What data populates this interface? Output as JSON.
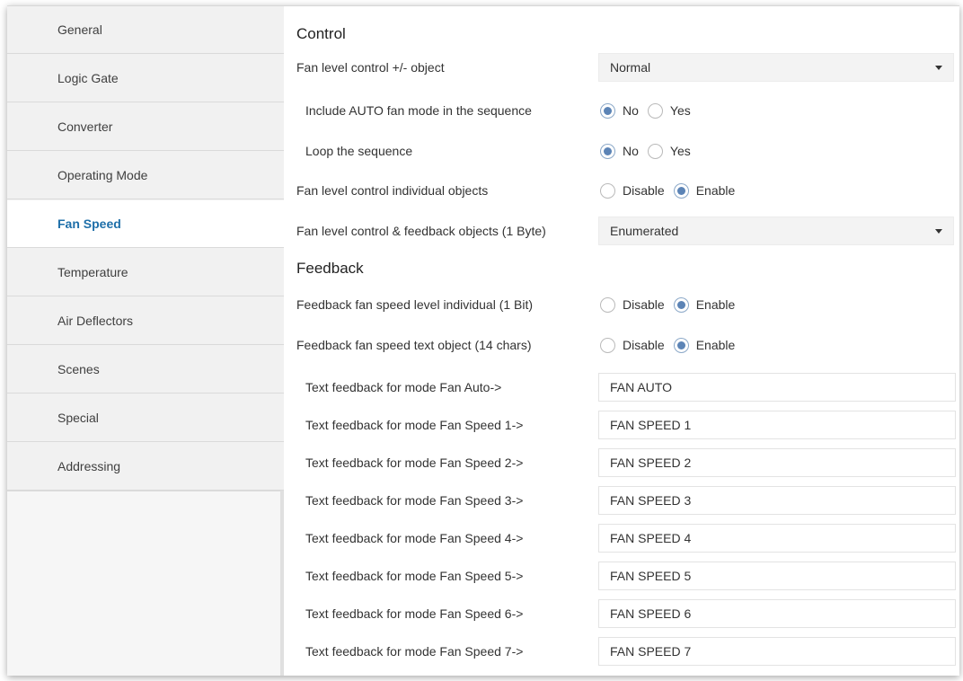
{
  "sidebar": {
    "items": [
      {
        "label": "General"
      },
      {
        "label": "Logic Gate"
      },
      {
        "label": "Converter"
      },
      {
        "label": "Operating Mode"
      },
      {
        "label": "Fan Speed",
        "active": true
      },
      {
        "label": "Temperature"
      },
      {
        "label": "Air Deflectors"
      },
      {
        "label": "Scenes"
      },
      {
        "label": "Special"
      },
      {
        "label": "Addressing"
      }
    ]
  },
  "control": {
    "title": "Control",
    "fan_level_pm": {
      "label": "Fan level control +/- object",
      "value": "Normal"
    },
    "include_auto": {
      "label": "Include AUTO fan mode in the sequence",
      "options": [
        "No",
        "Yes"
      ],
      "selected": "No"
    },
    "loop_sequence": {
      "label": "Loop the sequence",
      "options": [
        "No",
        "Yes"
      ],
      "selected": "No"
    },
    "individual_objects": {
      "label": "Fan level control individual objects",
      "options": [
        "Disable",
        "Enable"
      ],
      "selected": "Enable"
    },
    "byte_objects": {
      "label": "Fan level control & feedback objects (1 Byte)",
      "value": "Enumerated"
    }
  },
  "feedback": {
    "title": "Feedback",
    "level_individual": {
      "label": "Feedback fan speed level individual (1 Bit)",
      "options": [
        "Disable",
        "Enable"
      ],
      "selected": "Enable"
    },
    "text_object": {
      "label": "Feedback fan speed text object (14 chars)",
      "options": [
        "Disable",
        "Enable"
      ],
      "selected": "Enable"
    },
    "texts": [
      {
        "label": "Text feedback for mode Fan Auto->",
        "value": "FAN AUTO"
      },
      {
        "label": "Text feedback for mode Fan Speed 1->",
        "value": "FAN SPEED 1"
      },
      {
        "label": "Text feedback for mode Fan Speed 2->",
        "value": "FAN SPEED 2"
      },
      {
        "label": "Text feedback for mode Fan Speed 3->",
        "value": "FAN SPEED 3"
      },
      {
        "label": "Text feedback for mode Fan Speed 4->",
        "value": "FAN SPEED 4"
      },
      {
        "label": "Text feedback for mode Fan Speed 5->",
        "value": "FAN SPEED 5"
      },
      {
        "label": "Text feedback for mode Fan Speed 6->",
        "value": "FAN SPEED 6"
      },
      {
        "label": "Text feedback for mode Fan Speed 7->",
        "value": "FAN SPEED 7"
      }
    ]
  },
  "colors": {
    "accent": "#1e6fa9",
    "radio_fill": "#5c84b6",
    "sidebar_bg": "#f1f1f1"
  }
}
